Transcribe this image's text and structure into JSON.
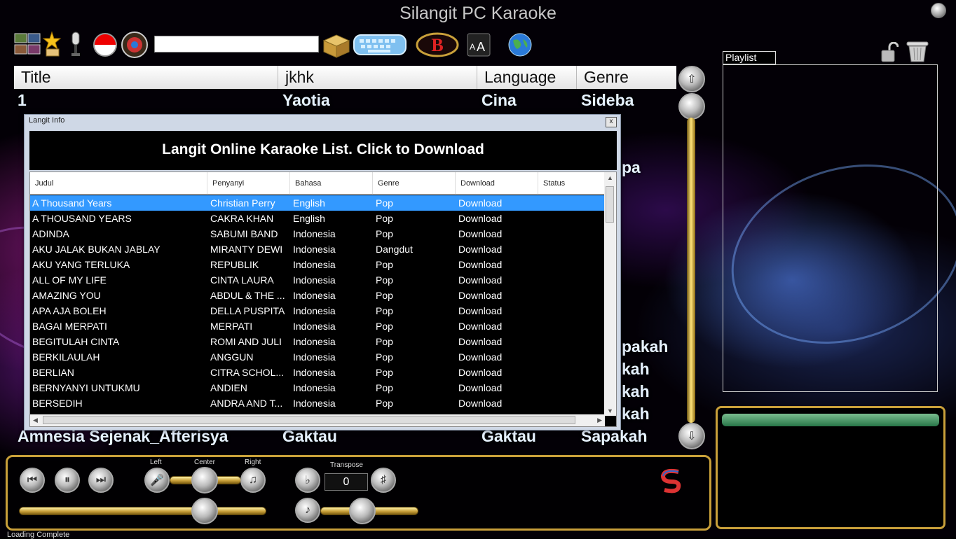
{
  "app": {
    "title": "Silangit PC Karaoke"
  },
  "search": {
    "value": ""
  },
  "song_list": {
    "columns": [
      "Title",
      "jkhk",
      "Language",
      "Genre"
    ],
    "rows": [
      {
        "title": "1",
        "artist": "Yaotia",
        "language": "Cina",
        "genre": "Sideba"
      },
      {
        "title": "Amnesia Sejenak_Afterisya",
        "artist": "Gaktau",
        "language": "Gaktau",
        "genre": "Sapakah"
      }
    ],
    "partial_right": [
      "pa",
      "pakah",
      "kah",
      "kah",
      "kah"
    ]
  },
  "playlist": {
    "tab_label": "Playlist"
  },
  "controls": {
    "left_label": "Left",
    "center_label": "Center",
    "right_label": "Right",
    "transpose_label": "Transpose",
    "transpose_value": "0"
  },
  "status": {
    "text": "Loading Complete"
  },
  "dialog": {
    "title": "Langit Info",
    "close": "x",
    "banner": "Langit Online Karaoke List. Click to Download",
    "columns": [
      "Judul",
      "Penyanyi",
      "Bahasa",
      "Genre",
      "Download",
      "Status"
    ],
    "rows": [
      {
        "judul": "A Thousand Years",
        "penyanyi": "Christian Perry",
        "bahasa": "English",
        "genre": "Pop",
        "download": "Download",
        "status": ""
      },
      {
        "judul": "A THOUSAND YEARS",
        "penyanyi": "CAKRA KHAN",
        "bahasa": "English",
        "genre": "Pop",
        "download": "Download",
        "status": ""
      },
      {
        "judul": "ADINDA",
        "penyanyi": "SABUMI BAND",
        "bahasa": "Indonesia",
        "genre": "Pop",
        "download": "Download",
        "status": ""
      },
      {
        "judul": "AKU JALAK BUKAN JABLAY",
        "penyanyi": "MIRANTY DEWI",
        "bahasa": "Indonesia",
        "genre": "Dangdut",
        "download": "Download",
        "status": ""
      },
      {
        "judul": "AKU YANG TERLUKA",
        "penyanyi": "REPUBLIK",
        "bahasa": "Indonesia",
        "genre": "Pop",
        "download": "Download",
        "status": ""
      },
      {
        "judul": "ALL OF MY LIFE",
        "penyanyi": "CINTA LAURA",
        "bahasa": "Indonesia",
        "genre": "Pop",
        "download": "Download",
        "status": ""
      },
      {
        "judul": "AMAZING YOU",
        "penyanyi": "ABDUL & THE ...",
        "bahasa": "Indonesia",
        "genre": "Pop",
        "download": "Download",
        "status": ""
      },
      {
        "judul": "APA AJA BOLEH",
        "penyanyi": "DELLA PUSPITA",
        "bahasa": "Indonesia",
        "genre": "Pop",
        "download": "Download",
        "status": ""
      },
      {
        "judul": "BAGAI MERPATI",
        "penyanyi": "MERPATI",
        "bahasa": "Indonesia",
        "genre": "Pop",
        "download": "Download",
        "status": ""
      },
      {
        "judul": "BEGITULAH CINTA",
        "penyanyi": "ROMI AND JULI",
        "bahasa": "Indonesia",
        "genre": "Pop",
        "download": "Download",
        "status": ""
      },
      {
        "judul": "BERKILAULAH",
        "penyanyi": "ANGGUN",
        "bahasa": "Indonesia",
        "genre": "Pop",
        "download": "Download",
        "status": ""
      },
      {
        "judul": "BERLIAN",
        "penyanyi": "CITRA SCHOL...",
        "bahasa": "Indonesia",
        "genre": "Pop",
        "download": "Download",
        "status": ""
      },
      {
        "judul": "BERNYANYI UNTUKMU",
        "penyanyi": "ANDIEN",
        "bahasa": "Indonesia",
        "genre": "Pop",
        "download": "Download",
        "status": ""
      },
      {
        "judul": "BERSEDIH",
        "penyanyi": "ANDRA AND T...",
        "bahasa": "Indonesia",
        "genre": "Pop",
        "download": "Download",
        "status": ""
      }
    ],
    "selected_row": 0
  },
  "icons": [
    "video-mode-icon",
    "favorite-icon",
    "microphone-icon",
    "indonesia-flag-icon",
    "karaoke-logo-icon",
    "open-folder-icon",
    "keyboard-icon",
    "b-logo-icon",
    "font-size-icon",
    "globe-icon",
    "unlock-icon",
    "trash-icon",
    "prev-icon",
    "pause-icon",
    "next-icon",
    "flat-icon",
    "sharp-icon",
    "s-logo-icon"
  ],
  "colors": {
    "selection": "#3399ff",
    "gold": "#c9a03a"
  }
}
